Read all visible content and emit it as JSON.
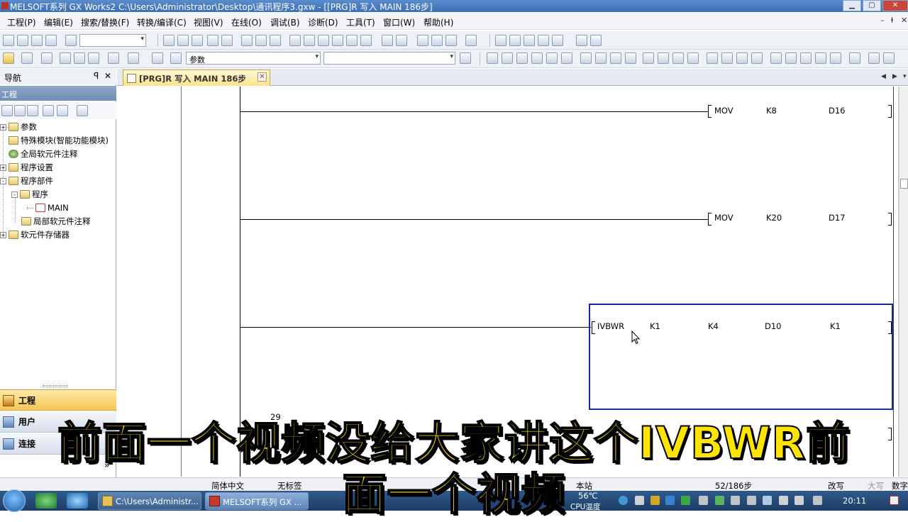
{
  "window": {
    "title": "MELSOFT系列 GX Works2 C:\\Users\\Administrator\\Desktop\\通讯程序3.gxw - [[PRG]R 写入 MAIN 186步]"
  },
  "menu": [
    "工程(P)",
    "编辑(E)",
    "搜索/替换(F)",
    "转换/编译(C)",
    "视图(V)",
    "在线(O)",
    "调试(B)",
    "诊断(D)",
    "工具(T)",
    "窗口(W)",
    "帮助(H)"
  ],
  "toolbar": {
    "param_combo": "参数"
  },
  "navigation": {
    "header": "导航",
    "pin": "ꟼ",
    "close": "✕",
    "project_label": "工程",
    "tree": [
      {
        "label": "参数",
        "level": 0,
        "expander": "+"
      },
      {
        "label": "特殊模块(智能功能模块)",
        "level": 0,
        "expander": ""
      },
      {
        "label": "全局软元件注释",
        "level": 0,
        "expander": ""
      },
      {
        "label": "程序设置",
        "level": 0,
        "expander": "+"
      },
      {
        "label": "程序部件",
        "level": 0,
        "expander": "-"
      },
      {
        "label": "程序",
        "level": 1,
        "expander": "-"
      },
      {
        "label": "MAIN",
        "level": 2,
        "expander": ""
      },
      {
        "label": "局部软元件注释",
        "level": 1,
        "expander": ""
      },
      {
        "label": "软元件存储器",
        "level": 0,
        "expander": "+"
      }
    ],
    "buttons": {
      "project": "工程",
      "user_lib": "用户",
      "connect": "连接"
    },
    "more": "»"
  },
  "editor": {
    "tab_label": "[PRG]R 写入 MAIN 186步",
    "tab_close": "✕",
    "step_fragment": "29",
    "rungs": [
      {
        "instruction": "MOV",
        "operands": [
          "K8",
          "D16"
        ]
      },
      {
        "instruction": "MOV",
        "operands": [
          "K20",
          "D17"
        ]
      },
      {
        "instruction": "IVBWR",
        "operands": [
          "K1",
          "K4",
          "D10",
          "K1"
        ]
      }
    ]
  },
  "statusbar": {
    "language": "简体中文",
    "label": "无标签",
    "slash": "/",
    "station": "本站",
    "steps": "52/186步",
    "mode": "改写",
    "caps": "大写",
    "num": "数字"
  },
  "taskbar": {
    "task1": "C:\\Users\\Administr...",
    "task2": "MELSOFT系列 GX ...",
    "temp": "56℃",
    "temp_label": "CPU温度",
    "time": "20:11"
  },
  "subtitle": {
    "line1": "前面一个视频没给大家讲这个IVBWR前",
    "line2": "面一个视频"
  }
}
